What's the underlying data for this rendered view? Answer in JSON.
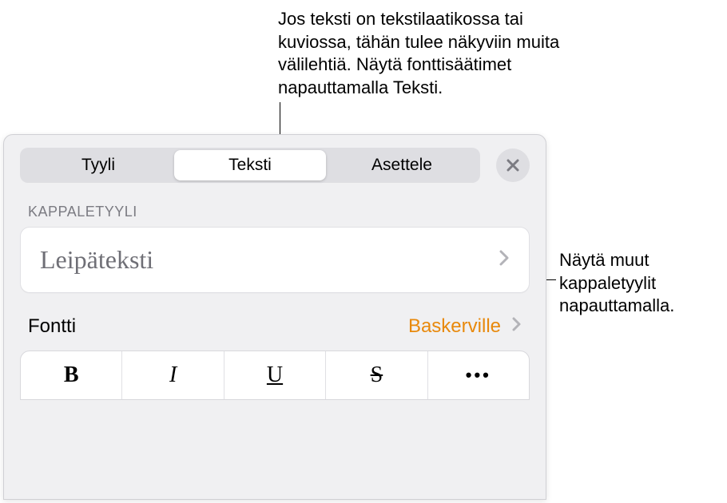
{
  "callouts": {
    "top": "Jos teksti on tekstilaatikossa tai kuviossa, tähän tulee näkyviin muita välilehtiä. Näytä fonttisäätimet napauttamalla Teksti.",
    "right": "Näytä muut kappaletyylit napauttamalla."
  },
  "tabs": {
    "style": "Tyyli",
    "text": "Teksti",
    "layout": "Asettele"
  },
  "section_header": "KAPPALETYYLI",
  "paragraph_style": {
    "value": "Leipäteksti"
  },
  "font": {
    "label": "Fontti",
    "value": "Baskerville"
  },
  "format_buttons": {
    "bold": "B",
    "italic": "I",
    "underline": "U",
    "strike": "S",
    "more": "•••"
  }
}
